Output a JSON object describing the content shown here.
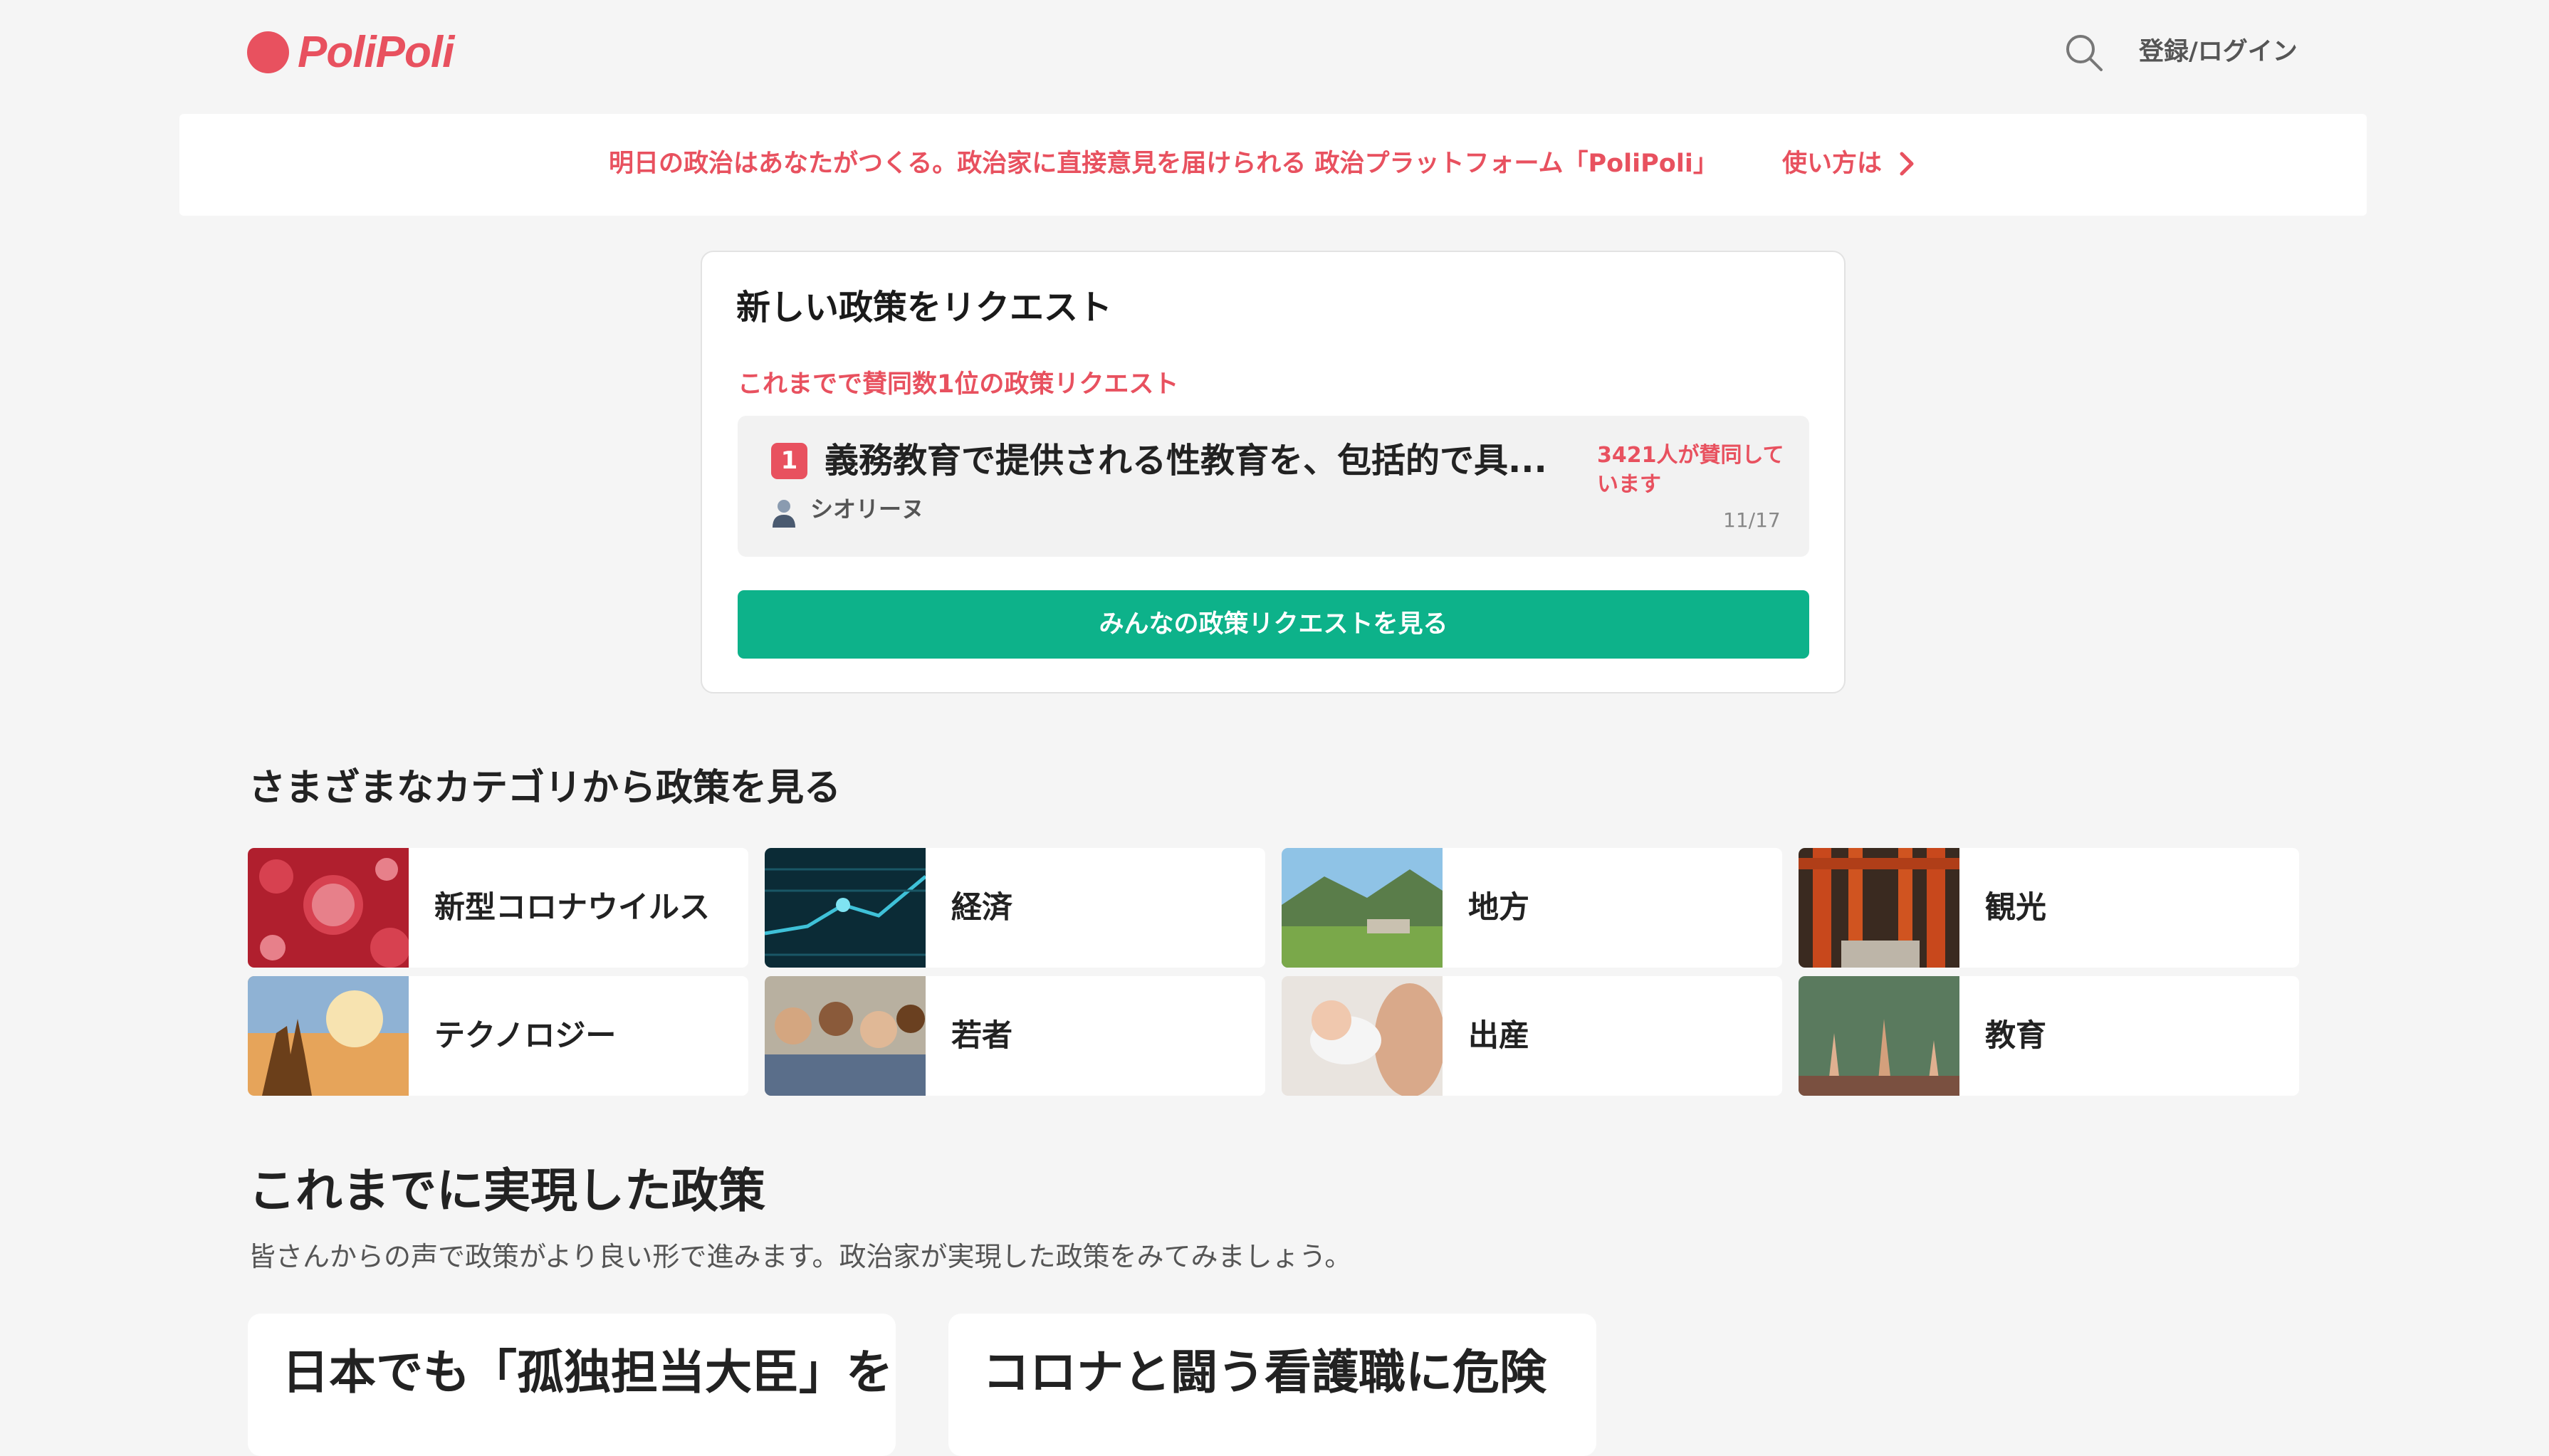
{
  "header": {
    "logo_text": "PoliPoli",
    "login_label": "登録/ログイン",
    "brand_color": "#e8515f"
  },
  "banner": {
    "text": "明日の政治はあなたがつくる。政治家に直接意見を届けられる 政治プラットフォーム「PoliPoli」",
    "howto_label": "使い方は"
  },
  "request": {
    "title": "新しい政策をリクエスト",
    "subtitle": "これまでで賛同数1位の政策リクエスト",
    "top_item": {
      "rank": "1",
      "title": "義務教育で提供される性教育を、包括的で具...",
      "support": "3421人が賛同しています",
      "author": "シオリーヌ",
      "date": "11/17"
    },
    "see_all_label": "みんなの政策リクエストを見る",
    "accent_color": "#0db28a"
  },
  "categories": {
    "heading": "さまざまなカテゴリから政策を見る",
    "items": [
      {
        "label": "新型コロナウイルス",
        "icon": "virus-image"
      },
      {
        "label": "経済",
        "icon": "circuit-image"
      },
      {
        "label": "地方",
        "icon": "landscape-image"
      },
      {
        "label": "観光",
        "icon": "torii-image"
      },
      {
        "label": "テクノロジー",
        "icon": "hand-light-image"
      },
      {
        "label": "若者",
        "icon": "friends-image"
      },
      {
        "label": "出産",
        "icon": "baby-image"
      },
      {
        "label": "教育",
        "icon": "raised-hands-image"
      }
    ]
  },
  "realized": {
    "heading": "これまでに実現した政策",
    "description": "皆さんからの声で政策がより良い形で進みます。政治家が実現した政策をみてみましょう。",
    "cards": [
      {
        "title": "日本でも「孤独担当大臣」を"
      },
      {
        "title": "コロナと闘う看護職に危険"
      }
    ]
  }
}
